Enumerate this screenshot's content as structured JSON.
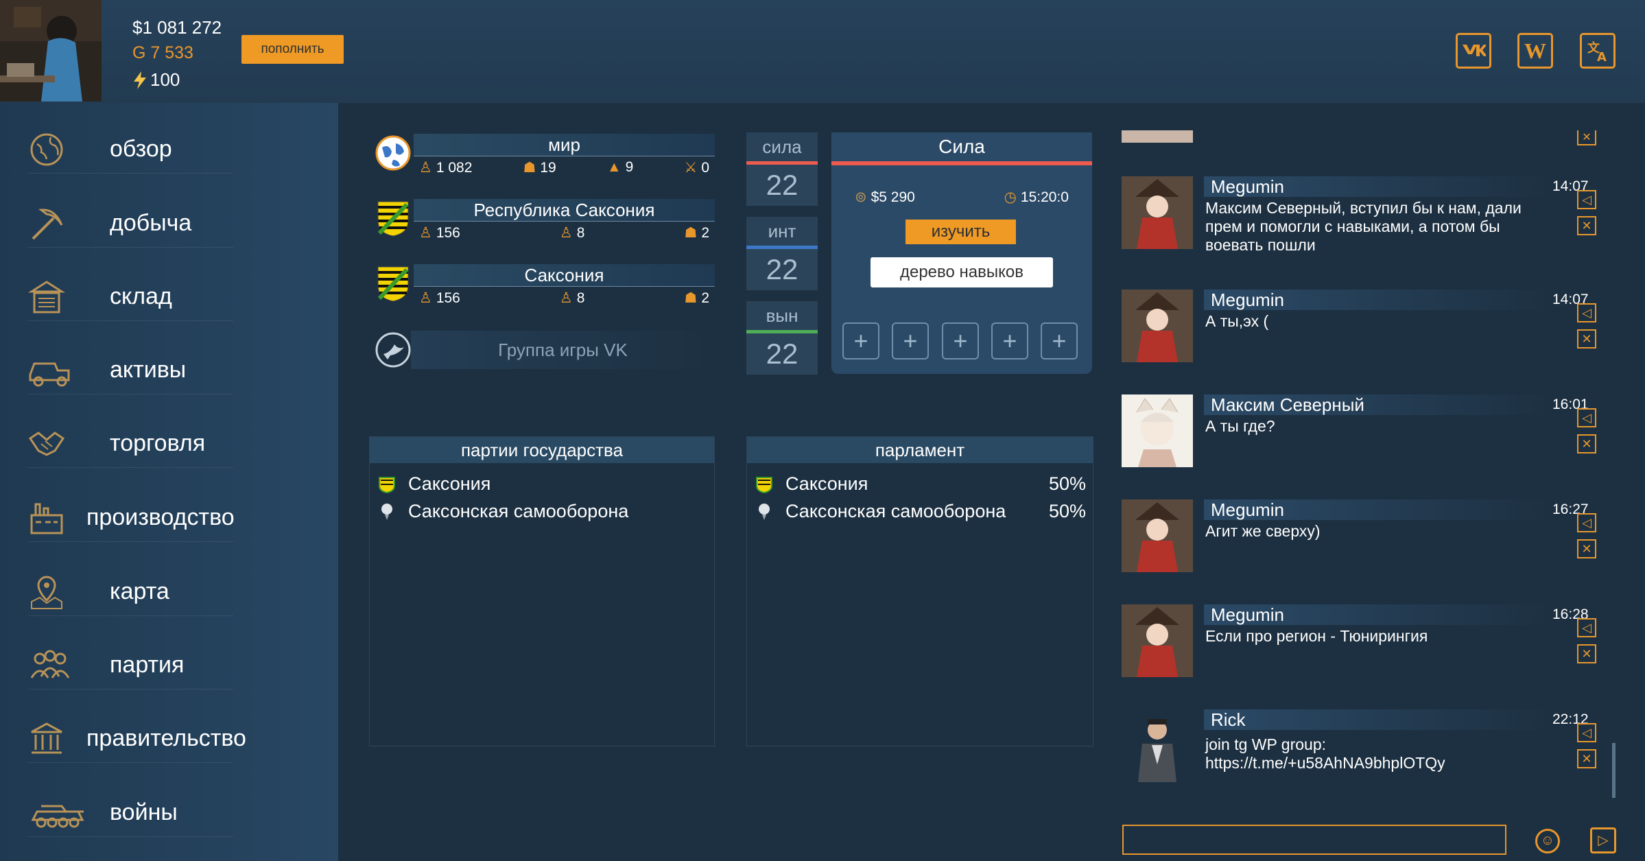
{
  "header": {
    "money": "$1 081 272",
    "gold": "G 7 533",
    "energy": "100",
    "topup_label": "пополнить",
    "icons": [
      "vk-icon",
      "wiki-icon",
      "translate-icon"
    ],
    "colors": {
      "accent": "#ef9a24",
      "bg": "#22384a"
    }
  },
  "sidebar": {
    "items": [
      {
        "label": "обзор",
        "icon": "globe-icon"
      },
      {
        "label": "добыча",
        "icon": "pickaxe-icon"
      },
      {
        "label": "склад",
        "icon": "warehouse-icon"
      },
      {
        "label": "активы",
        "icon": "truck-icon"
      },
      {
        "label": "торговля",
        "icon": "handshake-icon"
      },
      {
        "label": "производство",
        "icon": "factory-icon"
      },
      {
        "label": "карта",
        "icon": "map-icon"
      },
      {
        "label": "партия",
        "icon": "people-icon"
      },
      {
        "label": "правительство",
        "icon": "government-icon"
      },
      {
        "label": "войны",
        "icon": "tank-icon"
      }
    ]
  },
  "stats": {
    "world": {
      "title": "мир",
      "v1": "1 082",
      "v2": "19",
      "v3": "9",
      "v4": "0"
    },
    "republic": {
      "title": "Республика Саксония",
      "v1": "156",
      "v2": "8",
      "v3": "2"
    },
    "region": {
      "title": "Саксония",
      "v1": "156",
      "v2": "8",
      "v3": "2"
    },
    "vk_group": "Группа игры VK"
  },
  "attributes": [
    {
      "label": "сила",
      "value": "22",
      "color": "#ec5b4e"
    },
    {
      "label": "инт",
      "value": "22",
      "color": "#3c77c8"
    },
    {
      "label": "вын",
      "value": "22",
      "color": "#4fae58"
    }
  ],
  "skill": {
    "title": "Сила",
    "cost": "$5 290",
    "time": "15:20:0",
    "learn": "изучить",
    "tree": "дерево навыков"
  },
  "parties": {
    "title": "партии государства",
    "rows": [
      {
        "name": "Саксония"
      },
      {
        "name": "Саксонская самооборона"
      }
    ]
  },
  "parliament": {
    "title": "парламент",
    "rows": [
      {
        "name": "Саксония",
        "pct": "50%"
      },
      {
        "name": "Саксонская самооборона",
        "pct": "50%"
      }
    ]
  },
  "chat": {
    "messages": [
      {
        "name": "Megumin",
        "time": "14:07",
        "text": "Максим Северный, вступил бы к нам, дали прем и помогли с навыками, а потом бы воевать пошли",
        "avatar": "megumin"
      },
      {
        "name": "Megumin",
        "time": "14:07",
        "text": "А ты,эх (",
        "avatar": "megumin"
      },
      {
        "name": "Максим Северный",
        "time": "16:01",
        "text": "А ты где?",
        "avatar": "maxim"
      },
      {
        "name": "Megumin",
        "time": "16:27",
        "text": "Агит же сверху)",
        "avatar": "megumin"
      },
      {
        "name": "Megumin",
        "time": "16:28",
        "text": "Если про регион - Тюнирингия",
        "avatar": "megumin"
      },
      {
        "name": "Rick",
        "time": "22:12",
        "text": "join tg WP group: https://t.me/+u58AhNA9bhplOTQy",
        "avatar": "rick"
      }
    ],
    "input_placeholder": ""
  }
}
